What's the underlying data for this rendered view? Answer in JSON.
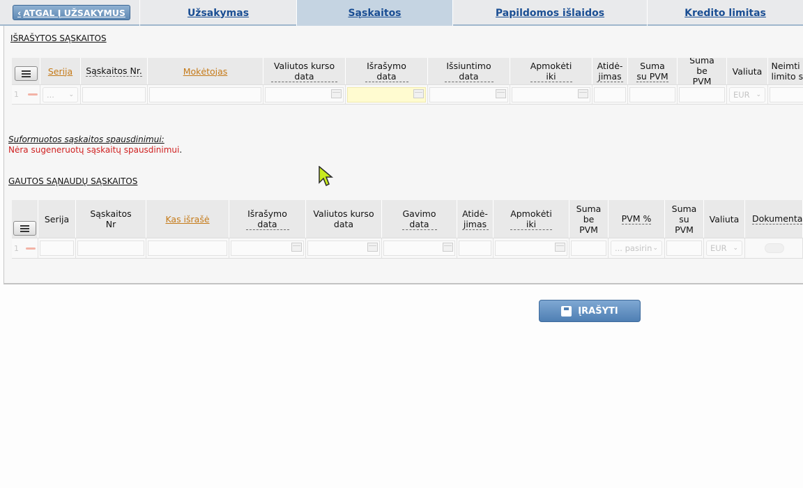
{
  "nav": {
    "back_label": "ATGAL Į UŽSAKYMUS",
    "tabs": [
      {
        "label": "Užsakymas",
        "active": false
      },
      {
        "label": "Sąskaitos",
        "active": true
      },
      {
        "label": "Papildomos išlaidos",
        "active": false
      },
      {
        "label": "Kredito limitas",
        "active": false
      }
    ]
  },
  "issued": {
    "title": "IŠRAŠYTOS SĄSKAITOS",
    "columns": [
      "Serija",
      "Sąskaitos Nr.",
      "Mokėtojas",
      "Valiutos kurso data",
      "Išrašymo data",
      "Išsiuntimo data",
      "Apmokėti iki",
      "Atidė-jimas",
      "Suma su PVM",
      "Suma be PVM",
      "Valiuta",
      "Neimti limito s"
    ],
    "row": {
      "num": "1",
      "series_value": "...",
      "currency": "EUR"
    }
  },
  "printed": {
    "title": "Suformuotos sąskaitos spausdinimui:",
    "message": "Nėra sugeneruotų sąskaitų spausdinimui",
    "message_end": "."
  },
  "received": {
    "title": "GAUTOS SĄNAUDŲ SĄSKAITOS",
    "columns": [
      "Serija",
      "Sąskaitos Nr",
      "Kas išrašė",
      "Išrašymo data",
      "Valiutos kurso data",
      "Gavimo data",
      "Atidė-jimas",
      "Apmokėti iki",
      "Suma be PVM",
      "PVM %",
      "Suma su PVM",
      "Valiuta",
      "Dokumenta"
    ],
    "row": {
      "num": "1",
      "vat_value": "... pasirin",
      "currency": "EUR"
    }
  },
  "actions": {
    "save_label": "ĮRAŠYTI"
  },
  "colors": {
    "accent": "#1a4e93",
    "sort_header": "#c57a18",
    "error": "#cf1f1f",
    "button": "#5f89b4"
  },
  "icons": [
    "chevron-left-icon",
    "menu-icon",
    "calendar-icon",
    "chevron-down-icon",
    "minus-icon",
    "save-icon",
    "document-icon",
    "cursor-icon"
  ]
}
